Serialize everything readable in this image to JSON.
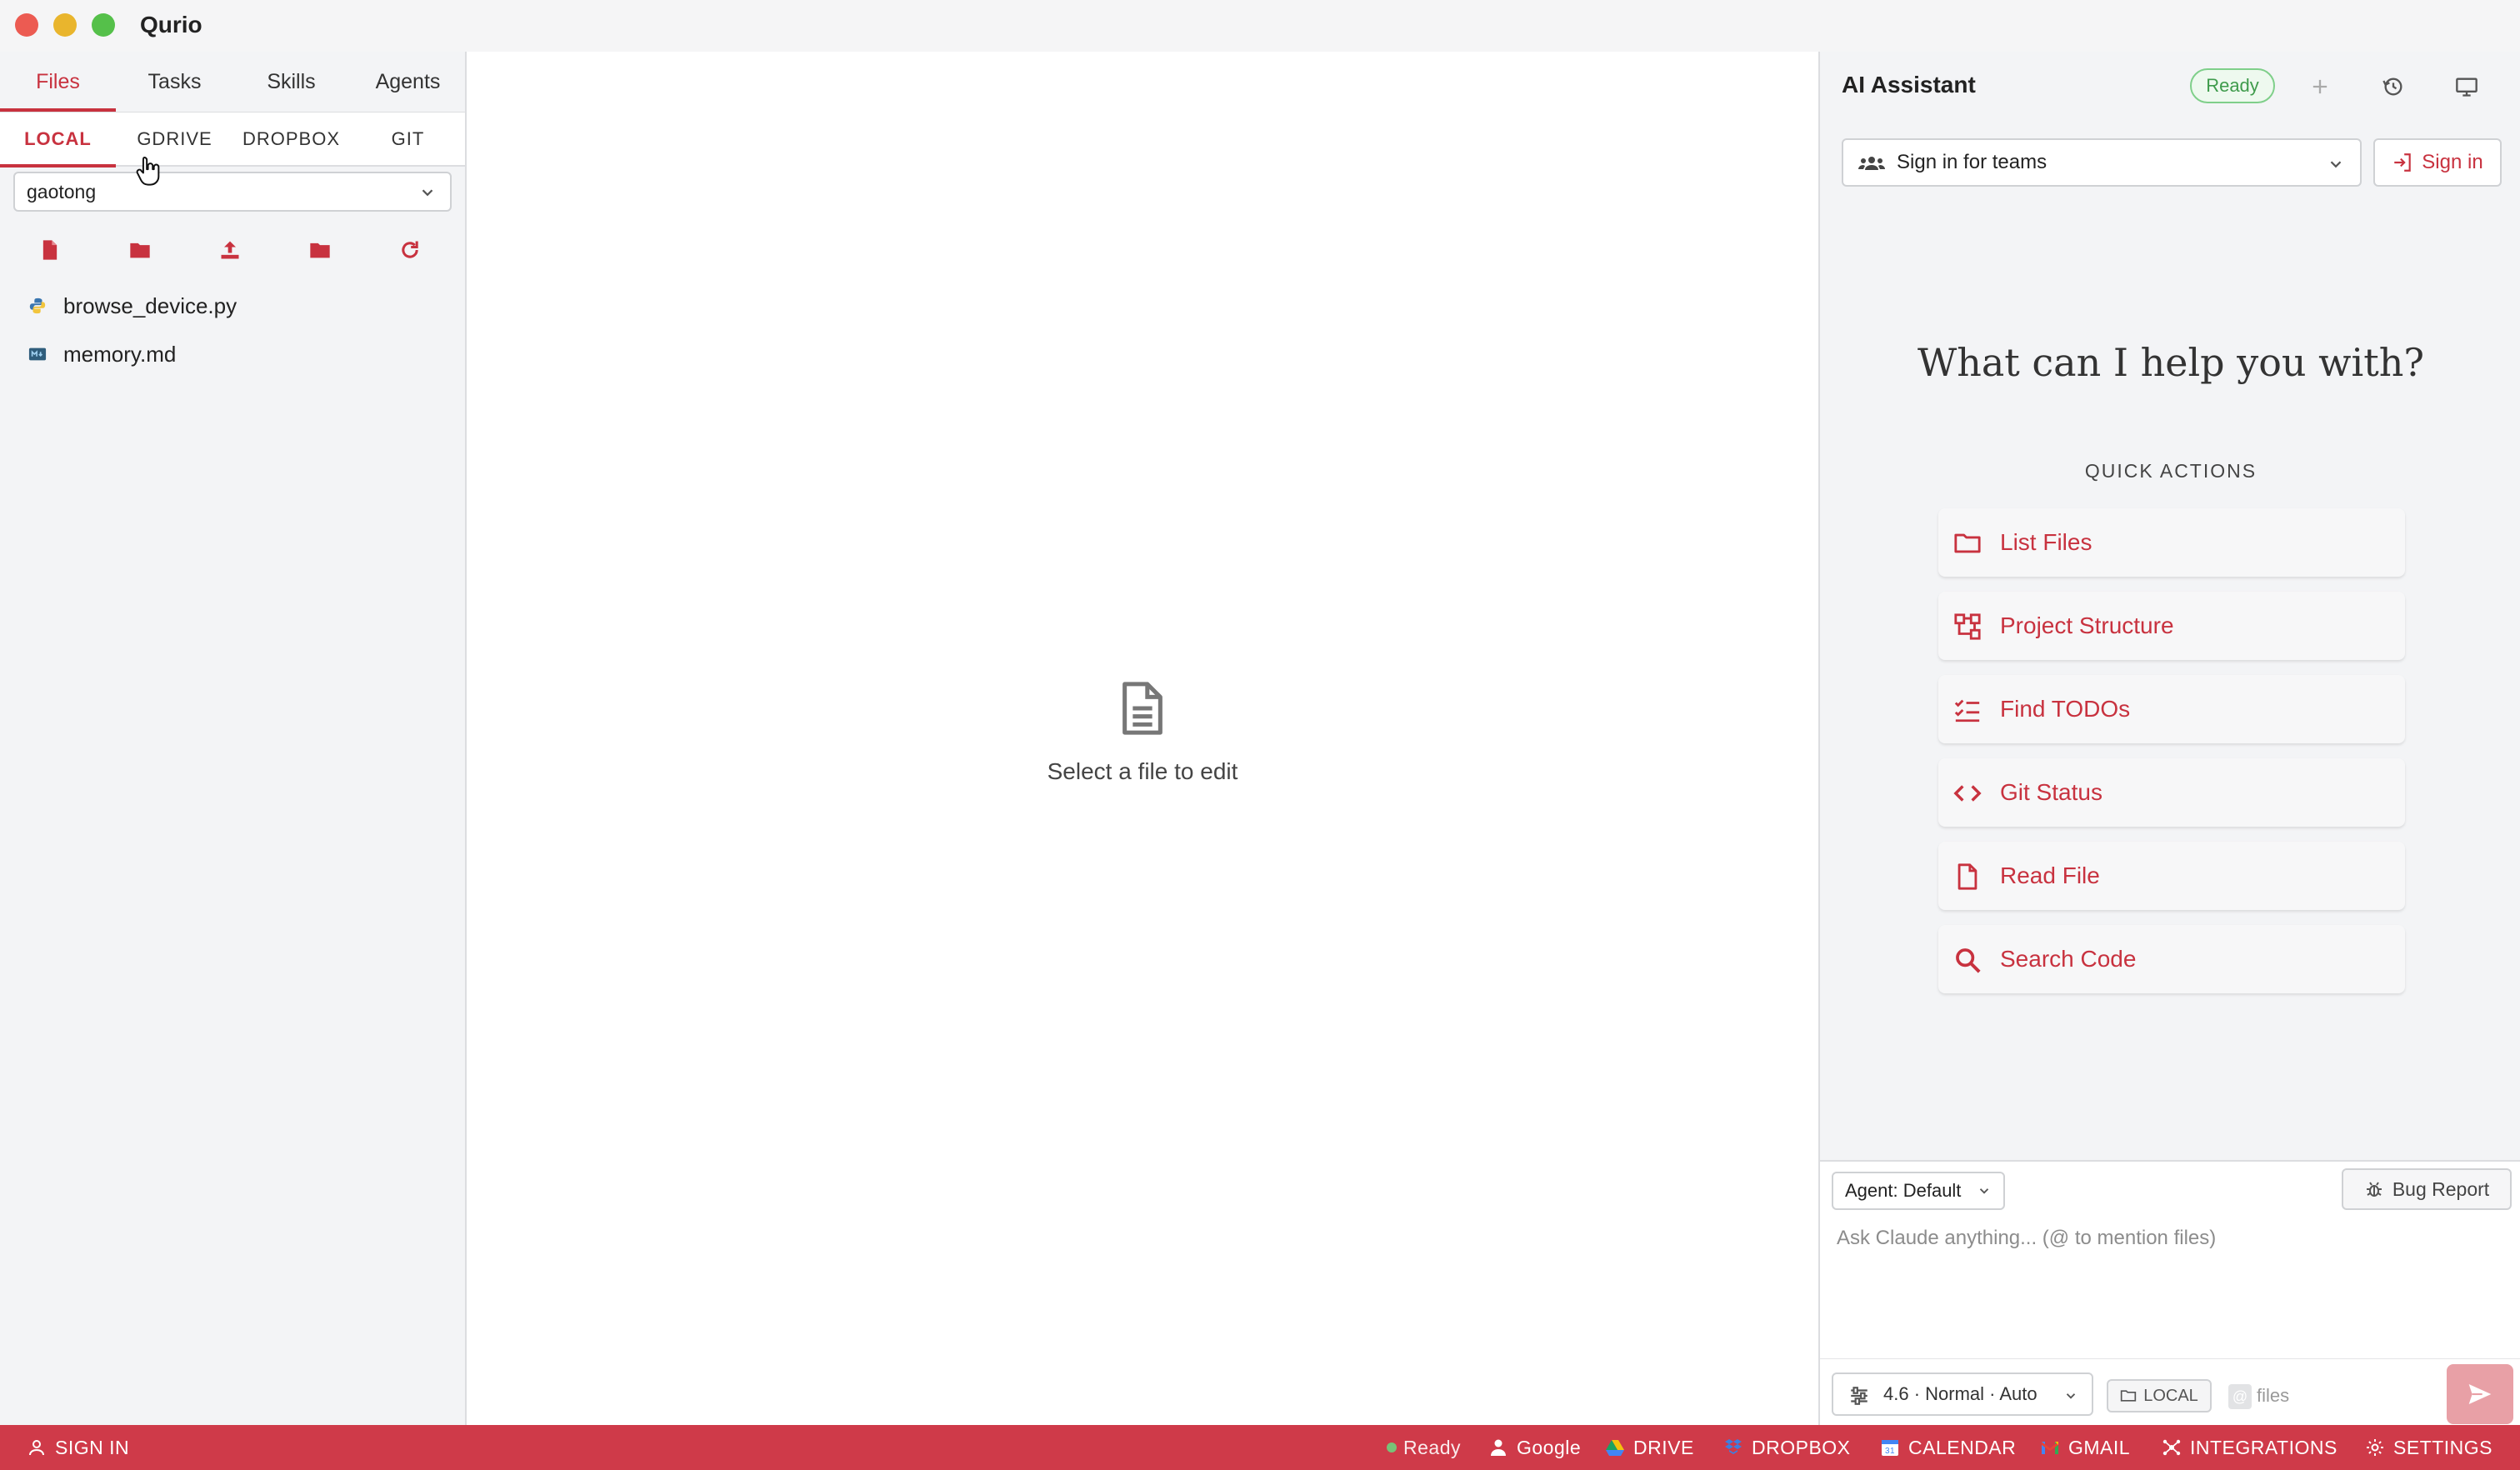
{
  "window": {
    "title": "Qurio"
  },
  "colors": {
    "accent": "#c8323f",
    "statusbar": "#cf3a49",
    "ready_green": "#3f9b4c"
  },
  "sidebar": {
    "main_tabs": [
      {
        "label": "Files",
        "active": true
      },
      {
        "label": "Tasks",
        "active": false
      },
      {
        "label": "Skills",
        "active": false
      },
      {
        "label": "Agents",
        "active": false
      }
    ],
    "storage_tabs": [
      {
        "label": "LOCAL",
        "active": true
      },
      {
        "label": "GDRIVE",
        "active": false
      },
      {
        "label": "DROPBOX",
        "active": false
      },
      {
        "label": "GIT",
        "active": false
      }
    ],
    "workspace": {
      "selected": "gaotong"
    },
    "toolbar_icons": [
      "new-file-icon",
      "new-folder-icon",
      "upload-icon",
      "open-folder-icon",
      "refresh-icon"
    ],
    "files": [
      {
        "name": "browse_device.py",
        "icon": "python-file-icon"
      },
      {
        "name": "memory.md",
        "icon": "markdown-file-icon"
      }
    ]
  },
  "editor": {
    "empty_text": "Select a file to edit"
  },
  "assistant": {
    "title": "AI Assistant",
    "status": "Ready",
    "team_select": "Sign in for teams",
    "sign_in": "Sign in",
    "heading": "What can I help you with?",
    "quick_actions_title": "QUICK ACTIONS",
    "quick_actions": [
      {
        "label": "List Files",
        "icon": "folder-icon"
      },
      {
        "label": "Project Structure",
        "icon": "structure-icon"
      },
      {
        "label": "Find TODOs",
        "icon": "checklist-icon"
      },
      {
        "label": "Git Status",
        "icon": "code-icon"
      },
      {
        "label": "Read File",
        "icon": "file-icon"
      },
      {
        "label": "Search Code",
        "icon": "search-icon"
      }
    ],
    "composer": {
      "agent": "Agent: Default",
      "bug_report": "Bug Report",
      "placeholder": "Ask Claude anything... (@ to mention files)",
      "model": "4.6 · Normal · Auto",
      "location": "LOCAL",
      "files_placeholder": "files",
      "at_symbol": "@"
    }
  },
  "statusbar": {
    "sign_in": "SIGN IN",
    "ready": "Ready",
    "google": "Google",
    "drive": "DRIVE",
    "dropbox": "DROPBOX",
    "calendar": "CALENDAR",
    "gmail": "GMAIL",
    "integrations": "INTEGRATIONS",
    "settings": "SETTINGS"
  }
}
